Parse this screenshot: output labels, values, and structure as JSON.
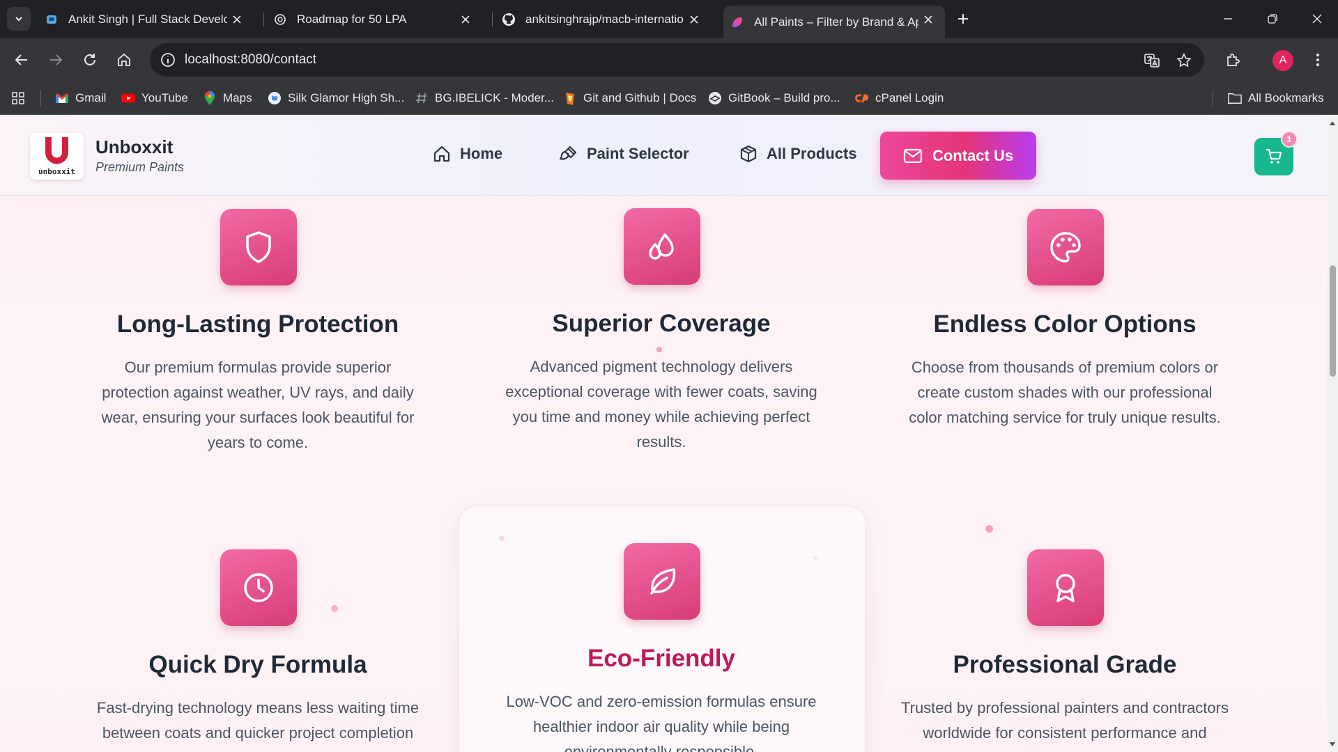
{
  "browser": {
    "tabs": [
      {
        "title": "Ankit Singh | Full Stack Develop",
        "icon": "portfolio-icon"
      },
      {
        "title": "Roadmap for 50 LPA",
        "icon": "openai-icon"
      },
      {
        "title": "ankitsinghrajp/macb-internation",
        "icon": "github-icon"
      },
      {
        "title": "All Paints – Filter by Brand & Ap",
        "icon": "paint-icon"
      }
    ],
    "url": "localhost:8080/contact",
    "avatar_letter": "A",
    "bookmarks": [
      {
        "label": "Gmail",
        "icon": "gmail-icon"
      },
      {
        "label": "YouTube",
        "icon": "youtube-icon"
      },
      {
        "label": "Maps",
        "icon": "maps-icon"
      },
      {
        "label": "Silk Glamor High Sh...",
        "icon": "silk-icon"
      },
      {
        "label": "BG.IBELICK - Moder...",
        "icon": "hash-icon"
      },
      {
        "label": "Git and Github | Docs",
        "icon": "git-docs-icon"
      },
      {
        "label": "GitBook – Build pro...",
        "icon": "gitbook-icon"
      },
      {
        "label": "cPanel Login",
        "icon": "cpanel-icon"
      }
    ],
    "all_bookmarks": "All Bookmarks"
  },
  "site": {
    "brand_name": "Unboxxit",
    "brand_tagline": "Premium Paints",
    "logo_word": "unboxxit",
    "nav": {
      "home": "Home",
      "paint_selector": "Paint Selector",
      "all_products": "All Products",
      "contact": "Contact Us"
    },
    "cart_count": "1",
    "colors": {
      "accent": "#ec4899",
      "accent_dark": "#be185d",
      "cart": "#17b890"
    }
  },
  "features": [
    {
      "title": "Long-Lasting Protection",
      "icon": "shield-icon",
      "desc": "Our premium formulas provide superior protection against weather, UV rays, and daily wear, ensuring your surfaces look beautiful for years to come."
    },
    {
      "title": "Superior Coverage",
      "icon": "droplets-icon",
      "desc": "Advanced pigment technology delivers exceptional coverage with fewer coats, saving you time and money while achieving perfect results."
    },
    {
      "title": "Endless Color Options",
      "icon": "palette-icon",
      "desc": "Choose from thousands of premium colors or create custom shades with our professional color matching service for truly unique results."
    },
    {
      "title": "Quick Dry Formula",
      "icon": "clock-icon",
      "desc": "Fast-drying technology means less waiting time between coats and quicker project completion"
    },
    {
      "title": "Eco-Friendly",
      "icon": "leaf-icon",
      "desc": "Low-VOC and zero-emission formulas ensure healthier indoor air quality while being environmentally responsible."
    },
    {
      "title": "Professional Grade",
      "icon": "award-icon",
      "desc": "Trusted by professional painters and contractors worldwide for consistent performance and"
    }
  ]
}
